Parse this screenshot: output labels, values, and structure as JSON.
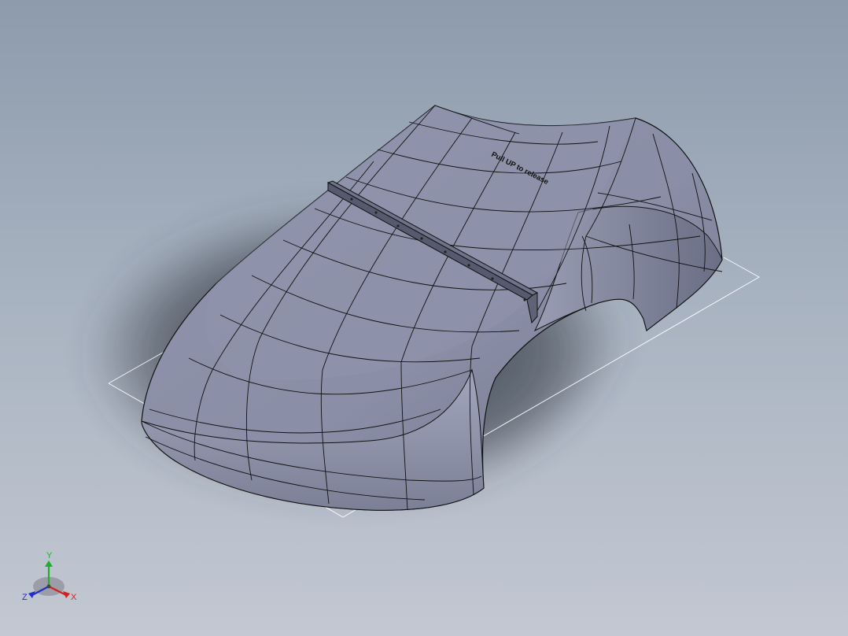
{
  "model": {
    "engraved_text": "Pull UP to release",
    "colors": {
      "body": "#8a8ea6",
      "body_highlight": "#a3a7bd",
      "body_dark": "#5f6379",
      "edge": "#111111",
      "shadow": "#3a3f4a",
      "sketch_plane": "#ffffff"
    }
  },
  "triad": {
    "x_label": "X",
    "y_label": "Y",
    "z_label": "Z",
    "colors": {
      "x": "#d42020",
      "y": "#1fae2a",
      "z": "#2030c8"
    }
  }
}
